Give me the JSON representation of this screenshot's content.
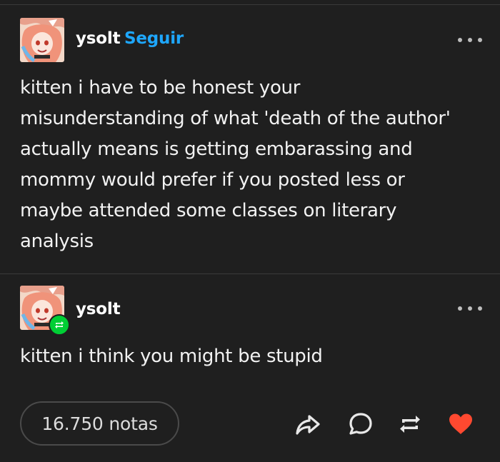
{
  "post": {
    "author": "ysolt",
    "follow_label": "Seguir",
    "text": "kitten i have to be honest your\nmisunderstanding of what 'death of the author'\nactually means is getting embarassing and\nmommy would prefer if you posted less or\nmaybe attended some classes on literary\nanalysis"
  },
  "reblog": {
    "author": "ysolt",
    "text": "kitten i think you might be stupid"
  },
  "footer": {
    "notes_label": "16.750 notas",
    "actions": [
      "share-icon",
      "reply-icon",
      "reblog-icon",
      "heart-icon"
    ]
  },
  "colors": {
    "background": "#1f1f1f",
    "follow_link": "#1ea7ff",
    "reblog_badge": "#00cf35",
    "like": "#ff4930"
  }
}
